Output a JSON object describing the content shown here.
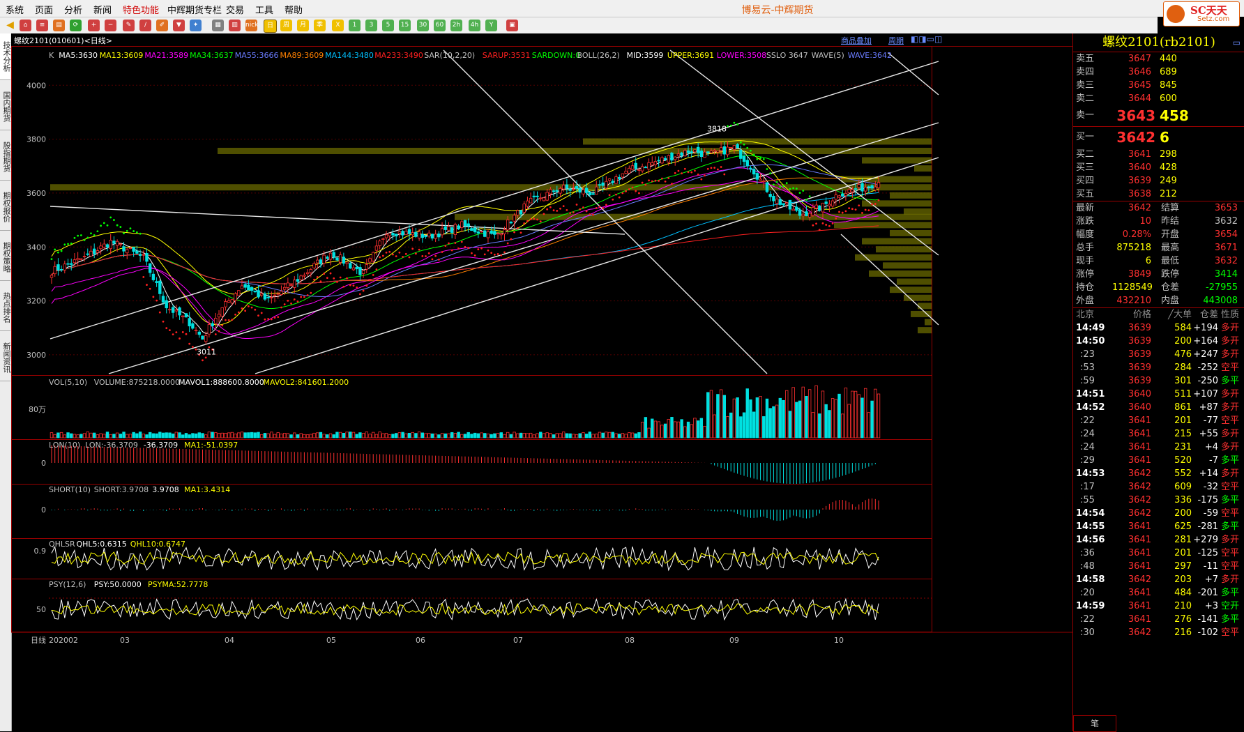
{
  "menu": [
    "系统",
    "页面",
    "分析",
    "新闻",
    "特色功能",
    "中辉期货专栏",
    "交易",
    "工具",
    "帮助"
  ],
  "app_title": "博易云-中辉期货",
  "logo": {
    "name": "SC天天",
    "sub": "Setz.com"
  },
  "toolbar_labels": [
    "nick",
    "日",
    "周",
    "月",
    "季",
    "X",
    "1",
    "3",
    "5",
    "15",
    "30",
    "60",
    "2h",
    "4h",
    "Y"
  ],
  "sidebar_tabs": [
    "技术分析",
    "国内期货",
    "股指期货",
    "期权报价",
    "期权策略",
    "热点排名",
    "新闻资讯"
  ],
  "chart_header": {
    "title": "螺纹2101(010601)<日线>",
    "link1": "商品叠加",
    "link2": "周期"
  },
  "price_legend": [
    {
      "t": "K",
      "c": "#c0c0c0"
    },
    {
      "t": "MA5:3630",
      "c": "#ffffff"
    },
    {
      "t": "MA13:3609",
      "c": "#ffff00"
    },
    {
      "t": "MA21:3589",
      "c": "#ff00ff"
    },
    {
      "t": "MA34:3637",
      "c": "#00ff00"
    },
    {
      "t": "MA55:3666",
      "c": "#6a7cff"
    },
    {
      "t": "MA89:3609",
      "c": "#ff8000"
    },
    {
      "t": "MA144:3480",
      "c": "#00c0ff"
    },
    {
      "t": "MA233:3490",
      "c": "#ff2020"
    },
    {
      "t": "SAR(10,2,20)",
      "c": "#c0c0c0"
    },
    {
      "t": "SARUP:3531",
      "c": "#ff2020"
    },
    {
      "t": "SARDOWN:0",
      "c": "#00ff00"
    },
    {
      "t": "BOLL(26,2)",
      "c": "#c0c0c0"
    },
    {
      "t": "MID:3599",
      "c": "#ffffff"
    },
    {
      "t": "UPPER:3691",
      "c": "#ffff00"
    },
    {
      "t": "LOWER:3508",
      "c": "#ff00ff"
    },
    {
      "t": "SSLO 3647",
      "c": "#c0c0c0"
    },
    {
      "t": "WAVE(5)",
      "c": "#c0c0c0"
    },
    {
      "t": "WAVE:3642",
      "c": "#6a7cff"
    }
  ],
  "price_axis": [
    "4000",
    "3800",
    "3600",
    "3400",
    "3200",
    "3000"
  ],
  "annotations": {
    "high": "3818",
    "low": "3011"
  },
  "vol_legend": [
    {
      "t": "VOL(5,10)",
      "c": "#c0c0c0"
    },
    {
      "t": "VOLUME:875218.0000",
      "c": "#c0c0c0"
    },
    {
      "t": "MAVOL1:888600.8000",
      "c": "#ffffff"
    },
    {
      "t": "MAVOL2:841601.2000",
      "c": "#ffff00"
    }
  ],
  "vol_axis": "80万",
  "lon_legend": [
    {
      "t": "LON(10)",
      "c": "#c0c0c0"
    },
    {
      "t": "LON:-36.3709",
      "c": "#c0c0c0"
    },
    {
      "t": "-36.3709",
      "c": "#ffffff"
    },
    {
      "t": "MA1:-51.0397",
      "c": "#ffff00"
    }
  ],
  "lon_axis": "0",
  "short_legend": [
    {
      "t": "SHORT(10)",
      "c": "#c0c0c0"
    },
    {
      "t": "SHORT:3.9708",
      "c": "#c0c0c0"
    },
    {
      "t": "3.9708",
      "c": "#ffffff"
    },
    {
      "t": "MA1:3.4314",
      "c": "#ffff00"
    }
  ],
  "short_axis": "0",
  "qhl_legend": [
    {
      "t": "QHLSR",
      "c": "#c0c0c0"
    },
    {
      "t": "QHL5:0.6315",
      "c": "#ffffff"
    },
    {
      "t": "QHL10:0.6747",
      "c": "#ffff00"
    }
  ],
  "qhl_axis": "0.9",
  "psy_legend": [
    {
      "t": "PSY(12,6)",
      "c": "#c0c0c0"
    },
    {
      "t": "PSY:50.0000",
      "c": "#ffffff"
    },
    {
      "t": "PSYMA:52.7778",
      "c": "#ffff00"
    }
  ],
  "psy_axis": "50",
  "date_axis": [
    "日线",
    "202002",
    "03",
    "04",
    "05",
    "06",
    "07",
    "08",
    "09",
    "10"
  ],
  "right_panel": {
    "title": "螺纹2101(rb2101)",
    "asks": [
      [
        "卖五",
        "3647",
        "440"
      ],
      [
        "卖四",
        "3646",
        "689"
      ],
      [
        "卖三",
        "3645",
        "845"
      ],
      [
        "卖二",
        "3644",
        "600"
      ]
    ],
    "ask1": [
      "卖一",
      "3643",
      "458"
    ],
    "bid1": [
      "买一",
      "3642",
      "6"
    ],
    "bids": [
      [
        "买二",
        "3641",
        "298"
      ],
      [
        "买三",
        "3640",
        "428"
      ],
      [
        "买四",
        "3639",
        "249"
      ],
      [
        "买五",
        "3638",
        "212"
      ]
    ],
    "stats": [
      [
        "最新",
        "3642",
        "结算",
        "3653"
      ],
      [
        "涨跌",
        "10",
        "昨结",
        "3632"
      ],
      [
        "幅度",
        "0.28%",
        "开盘",
        "3654"
      ],
      [
        "总手",
        "875218",
        "最高",
        "3671"
      ],
      [
        "现手",
        "6",
        "最低",
        "3632"
      ],
      [
        "涨停",
        "3849",
        "跌停",
        "3414"
      ],
      [
        "持仓",
        "1128549",
        "仓差",
        "-27955"
      ],
      [
        "外盘",
        "432210",
        "内盘",
        "443008"
      ]
    ],
    "tick_header": [
      "北京",
      "价格",
      "╱大单",
      "仓差",
      "性质"
    ],
    "ticks": [
      [
        "14:49",
        "3639",
        "584",
        "+194",
        "多开"
      ],
      [
        "14:50",
        "3639",
        "200",
        "+164",
        "多开"
      ],
      [
        ":23",
        "3639",
        "476",
        "+247",
        "多开"
      ],
      [
        ":53",
        "3639",
        "284",
        "-252",
        "空平"
      ],
      [
        ":59",
        "3639",
        "301",
        "-250",
        "多平"
      ],
      [
        "14:51",
        "3640",
        "511",
        "+107",
        "多开"
      ],
      [
        "14:52",
        "3640",
        "861",
        "+87",
        "多开"
      ],
      [
        ":22",
        "3641",
        "201",
        "-77",
        "空平"
      ],
      [
        ":24",
        "3641",
        "215",
        "+55",
        "多开"
      ],
      [
        ":24",
        "3641",
        "231",
        "+4",
        "多开"
      ],
      [
        ":29",
        "3641",
        "520",
        "-7",
        "多平"
      ],
      [
        "14:53",
        "3642",
        "552",
        "+14",
        "多开"
      ],
      [
        ":17",
        "3642",
        "609",
        "-32",
        "空平"
      ],
      [
        ":55",
        "3642",
        "336",
        "-175",
        "多平"
      ],
      [
        "14:54",
        "3642",
        "200",
        "-59",
        "空平"
      ],
      [
        "14:55",
        "3641",
        "625",
        "-281",
        "多平"
      ],
      [
        "14:56",
        "3641",
        "281",
        "+279",
        "多开"
      ],
      [
        ":36",
        "3641",
        "201",
        "-125",
        "空平"
      ],
      [
        ":48",
        "3641",
        "297",
        "-11",
        "空平"
      ],
      [
        "14:58",
        "3642",
        "203",
        "+7",
        "多开"
      ],
      [
        ":20",
        "3641",
        "484",
        "-201",
        "多平"
      ],
      [
        "14:59",
        "3641",
        "210",
        "+3",
        "空开"
      ],
      [
        ":22",
        "3641",
        "276",
        "-141",
        "多平"
      ],
      [
        ":30",
        "3642",
        "216",
        "-102",
        "空平"
      ]
    ],
    "bottom_tab": "笔"
  },
  "chart_data": {
    "type": "candlestick",
    "title": "螺纹2101(010601)<日线>",
    "ylim": [
      2930,
      4130
    ],
    "x_month_labels": [
      "202002",
      "03",
      "04",
      "05",
      "06",
      "07",
      "08",
      "09",
      "10"
    ],
    "keypoints": [
      {
        "i": 0,
        "c": 3310
      },
      {
        "i": 10,
        "c": 3360
      },
      {
        "i": 18,
        "c": 3420
      },
      {
        "i": 28,
        "c": 3360
      },
      {
        "i": 35,
        "c": 3180
      },
      {
        "i": 42,
        "c": 3120
      },
      {
        "i": 46,
        "c": 3060
      },
      {
        "i": 50,
        "c": 3140
      },
      {
        "i": 58,
        "c": 3260
      },
      {
        "i": 66,
        "c": 3200
      },
      {
        "i": 75,
        "c": 3280
      },
      {
        "i": 85,
        "c": 3380
      },
      {
        "i": 95,
        "c": 3300
      },
      {
        "i": 102,
        "c": 3460
      },
      {
        "i": 115,
        "c": 3440
      },
      {
        "i": 125,
        "c": 3480
      },
      {
        "i": 135,
        "c": 3440
      },
      {
        "i": 145,
        "c": 3560
      },
      {
        "i": 155,
        "c": 3620
      },
      {
        "i": 165,
        "c": 3600
      },
      {
        "i": 175,
        "c": 3680
      },
      {
        "i": 185,
        "c": 3720
      },
      {
        "i": 195,
        "c": 3760
      },
      {
        "i": 200,
        "c": 3740
      },
      {
        "i": 208,
        "c": 3770
      },
      {
        "i": 213,
        "c": 3700
      },
      {
        "i": 220,
        "c": 3580
      },
      {
        "i": 228,
        "c": 3520
      },
      {
        "i": 235,
        "c": 3550
      },
      {
        "i": 240,
        "c": 3600
      },
      {
        "i": 247,
        "c": 3620
      },
      {
        "i": 252,
        "c": 3642
      }
    ],
    "n_bars": 253
  }
}
